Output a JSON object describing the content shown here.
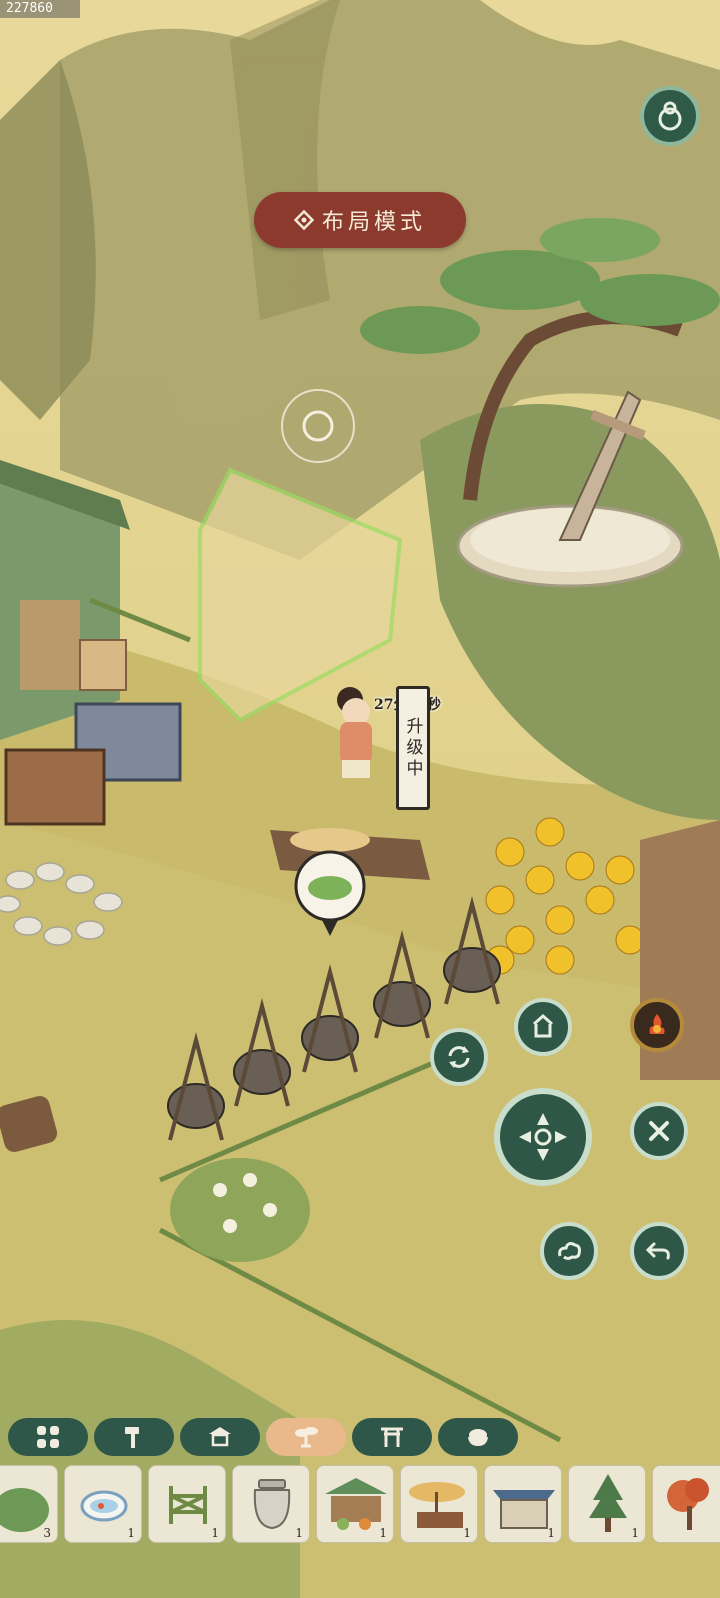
{
  "hud": {
    "session_id": "227860",
    "mode_banner": "布局模式",
    "timer": "27分44秒",
    "upgrade_label": "升级中"
  },
  "category_tabs": [
    {
      "icon": "grid-icon",
      "active": false
    },
    {
      "icon": "hammer-icon",
      "active": false
    },
    {
      "icon": "pavilion-icon",
      "active": false
    },
    {
      "icon": "bonsai-tree-icon",
      "active": true
    },
    {
      "icon": "gate-icon",
      "active": false
    },
    {
      "icon": "rice-bowl-icon",
      "active": false
    }
  ],
  "items": [
    {
      "icon": "bush-icon",
      "count": "3"
    },
    {
      "icon": "goldfish-bowl-icon",
      "count": "1"
    },
    {
      "icon": "fence-icon",
      "count": "1"
    },
    {
      "icon": "jar-icon",
      "count": "1"
    },
    {
      "icon": "vegetable-stall-icon",
      "count": "1"
    },
    {
      "icon": "umbrella-stall-icon",
      "count": "1"
    },
    {
      "icon": "market-stall-icon",
      "count": "1"
    },
    {
      "icon": "pine-tree-icon",
      "count": "1"
    },
    {
      "icon": "maple-tree-icon",
      "count": ""
    }
  ],
  "controls": [
    "store-icon",
    "rotate-icon",
    "move-icon",
    "cancel-icon",
    "cloud-icon",
    "undo-icon",
    "bonfire-icon"
  ],
  "colors": {
    "accent_green": "#2f5748",
    "banner_red": "#8c3a2e",
    "active_tab": "#e9b98c"
  }
}
